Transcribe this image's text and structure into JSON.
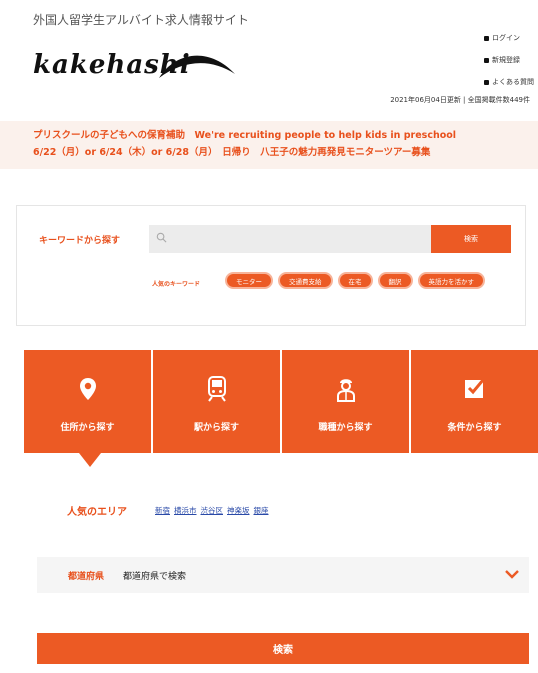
{
  "header": {
    "tagline": "外国人留学生アルバイト求人情報サイト",
    "logo_text": "kakehashi",
    "links": [
      {
        "label": "ログイン"
      },
      {
        "label": "新規登録"
      },
      {
        "label": "よくある質問"
      }
    ],
    "updated": "2021年06月04日更新 | 全国掲載件数449件"
  },
  "notice": {
    "line1": "プリスクールの子どもへの保育補助　We're recruiting people to help kids in preschool",
    "line2": "6/22（月）or 6/24（木）or 6/28（月）　日帰り　八王子の魅力再発見モニターツアー募集"
  },
  "keyword_search": {
    "label": "キーワードから探す",
    "placeholder": "",
    "button_label": "検索",
    "popular_label": "人気のキーワード",
    "tags": [
      "モニター",
      "交通費支給",
      "在宅",
      "翻訳",
      "英語力を活かす"
    ]
  },
  "tabs": [
    {
      "label": "住所から探す",
      "icon": "map-pin-icon"
    },
    {
      "label": "駅から探す",
      "icon": "train-icon"
    },
    {
      "label": "職種から探す",
      "icon": "worker-icon"
    },
    {
      "label": "条件から探す",
      "icon": "checkbox-icon"
    }
  ],
  "popular_area": {
    "label": "人気のエリア",
    "links": [
      "新宿",
      "横浜市",
      "渋谷区",
      "神楽坂",
      "銀座"
    ]
  },
  "prefecture": {
    "label": "都道府県",
    "value": "都道府県で検索"
  },
  "search_button": {
    "label": "検索"
  },
  "colors": {
    "accent": "#ec5a24",
    "notice_bg": "#fbf1ec",
    "link": "#2a4aa8"
  }
}
